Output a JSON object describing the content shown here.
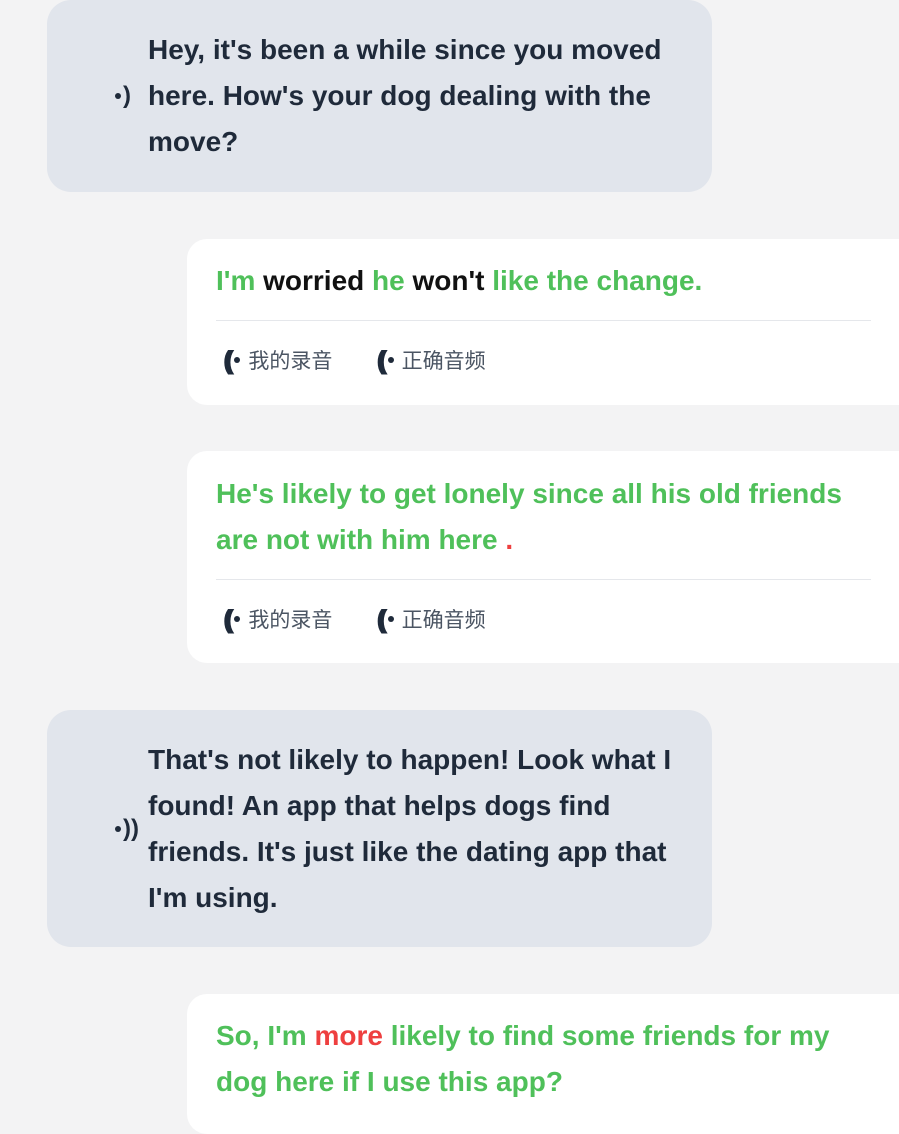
{
  "messages": [
    {
      "role": "partner",
      "text": "Hey, it's been a while since you moved here. How's your dog dealing with the move?"
    },
    {
      "role": "user",
      "segments": [
        {
          "text": "I'm ",
          "color": "green"
        },
        {
          "text": "worried",
          "color": "black"
        },
        {
          "text": " he ",
          "color": "green"
        },
        {
          "text": "won't",
          "color": "black"
        },
        {
          "text": " like the change.",
          "color": "green"
        }
      ]
    },
    {
      "role": "user",
      "segments": [
        {
          "text": "He's likely to get lonely since all his old friends are not with him here ",
          "color": "green"
        },
        {
          "text": ".",
          "color": "red"
        }
      ]
    },
    {
      "role": "partner",
      "text": "That's not likely to happen! Look what I found! An app that helps dogs find friends. It's just like the dating app that I'm using."
    },
    {
      "role": "user",
      "segments": [
        {
          "text": "So, I'm ",
          "color": "green"
        },
        {
          "text": "more",
          "color": "red"
        },
        {
          "text": " likely to find some friends for my dog here if I use this app?",
          "color": "green"
        }
      ]
    }
  ],
  "actions": {
    "my_recording": "我的录音",
    "correct_audio": "正确音频"
  },
  "colors": {
    "green": "#4fc05a",
    "black": "#111111",
    "red": "#ee3f3f",
    "partner_bg": "#e1e5ec"
  },
  "icons": [
    "speaker-icon",
    "recording-playback-icon",
    "correct-audio-icon"
  ]
}
